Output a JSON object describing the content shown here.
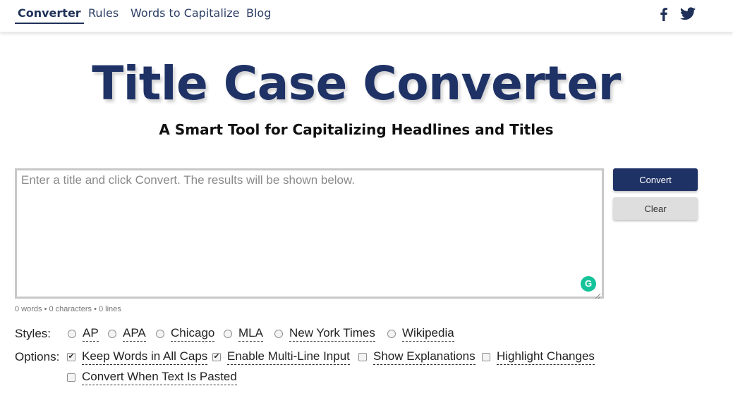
{
  "nav": {
    "items": [
      {
        "label": "Converter",
        "active": true
      },
      {
        "label": "Rules"
      },
      {
        "label": "Words to Capitalize"
      },
      {
        "label": "Blog"
      }
    ],
    "social": [
      "facebook-icon",
      "twitter-icon"
    ]
  },
  "hero": {
    "title": "Title Case Converter",
    "subtitle": "A Smart Tool for Capitalizing Headlines and Titles"
  },
  "editor": {
    "placeholder": "Enter a title and click Convert. The results will be shown below.",
    "value": "",
    "counter": "0 words • 0 characters • 0 lines",
    "grammarly_glyph": "G"
  },
  "buttons": {
    "convert": "Convert",
    "clear": "Clear"
  },
  "styles": {
    "label": "Styles:",
    "options": [
      "AP",
      "APA",
      "Chicago",
      "MLA",
      "New York Times",
      "Wikipedia"
    ],
    "selected": null
  },
  "options": {
    "label": "Options:",
    "items": [
      {
        "label": "Keep Words in All Caps",
        "checked": true
      },
      {
        "label": "Enable Multi-Line Input",
        "checked": true
      },
      {
        "label": "Show Explanations",
        "checked": false
      },
      {
        "label": "Highlight Changes",
        "checked": false
      },
      {
        "label": "Convert When Text Is Pasted",
        "checked": false
      }
    ]
  },
  "colors": {
    "brand": "#1f3266",
    "clear_button": "#dedede",
    "grammarly": "#15c39a"
  }
}
